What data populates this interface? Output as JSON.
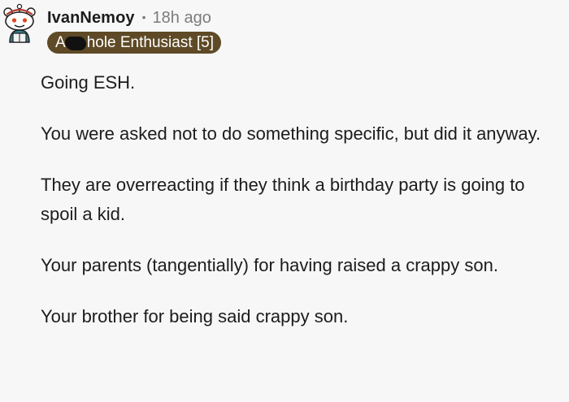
{
  "comment": {
    "username": "IvanNemoy",
    "separator": "•",
    "timestamp": "18h ago",
    "flair": {
      "prefix": "A",
      "suffix": "hole Enthusiast [5]",
      "bg_color": "#5e4a26"
    },
    "paragraphs": [
      "Going ESH.",
      "You were asked not to do something specific, but did it anyway.",
      "They are overreacting if they think a birthday party is going to spoil a kid.",
      "Your parents (tangentially) for having raised a crappy son.",
      "Your brother for being said crappy son."
    ],
    "avatar_icon": "snoo-avatar-icon"
  }
}
